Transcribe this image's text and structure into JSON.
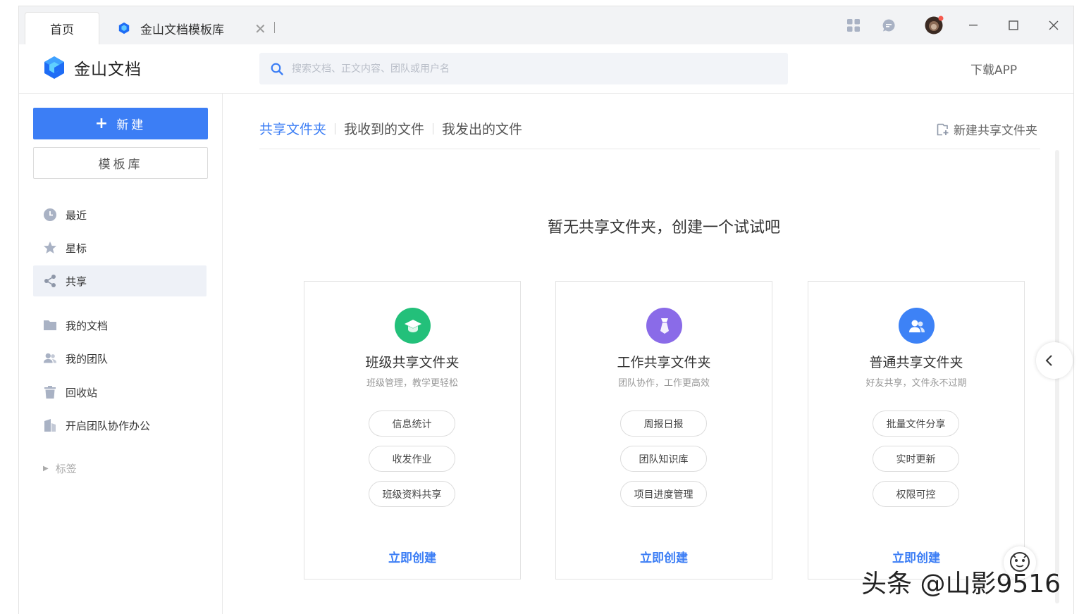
{
  "tabs": [
    {
      "label": "首页",
      "active": true
    },
    {
      "label": "金山文档模板库",
      "active": false
    }
  ],
  "header": {
    "brand": "金山文档",
    "search_placeholder": "搜索文档、正文内容、团队或用户名",
    "download": "下载APP"
  },
  "sidebar": {
    "new_button": "新建",
    "template_button": "模板库",
    "items": [
      {
        "label": "最近",
        "icon": "clock-icon"
      },
      {
        "label": "星标",
        "icon": "star-icon"
      },
      {
        "label": "共享",
        "icon": "share-icon",
        "active": true
      },
      {
        "label": "我的文档",
        "icon": "folder-icon"
      },
      {
        "label": "我的团队",
        "icon": "team-icon"
      },
      {
        "label": "回收站",
        "icon": "trash-icon"
      },
      {
        "label": "开启团队协作办公",
        "icon": "building-icon"
      }
    ],
    "tags": "标签"
  },
  "main": {
    "subtabs": [
      "共享文件夹",
      "我收到的文件",
      "我发出的文件"
    ],
    "new_shared": "新建共享文件夹",
    "empty_title": "暂无共享文件夹，创建一个试试吧",
    "cards": [
      {
        "title": "班级共享文件夹",
        "subtitle": "班级管理，教学更轻松",
        "features": [
          "信息统计",
          "收发作业",
          "班级资料共享"
        ],
        "action": "立即创建",
        "color": "#23c07a",
        "icon": "graduation-cap-icon"
      },
      {
        "title": "工作共享文件夹",
        "subtitle": "团队协作，工作更高效",
        "features": [
          "周报日报",
          "团队知识库",
          "项目进度管理"
        ],
        "action": "立即创建",
        "color": "#8a6be8",
        "icon": "tie-icon"
      },
      {
        "title": "普通共享文件夹",
        "subtitle": "好友共享，文件永不过期",
        "features": [
          "批量文件分享",
          "实时更新",
          "权限可控"
        ],
        "action": "立即创建",
        "color": "#3d82f6",
        "icon": "users-icon"
      }
    ]
  },
  "watermark": "头条 @山影9516",
  "colors": {
    "accent": "#3c7ef5"
  }
}
